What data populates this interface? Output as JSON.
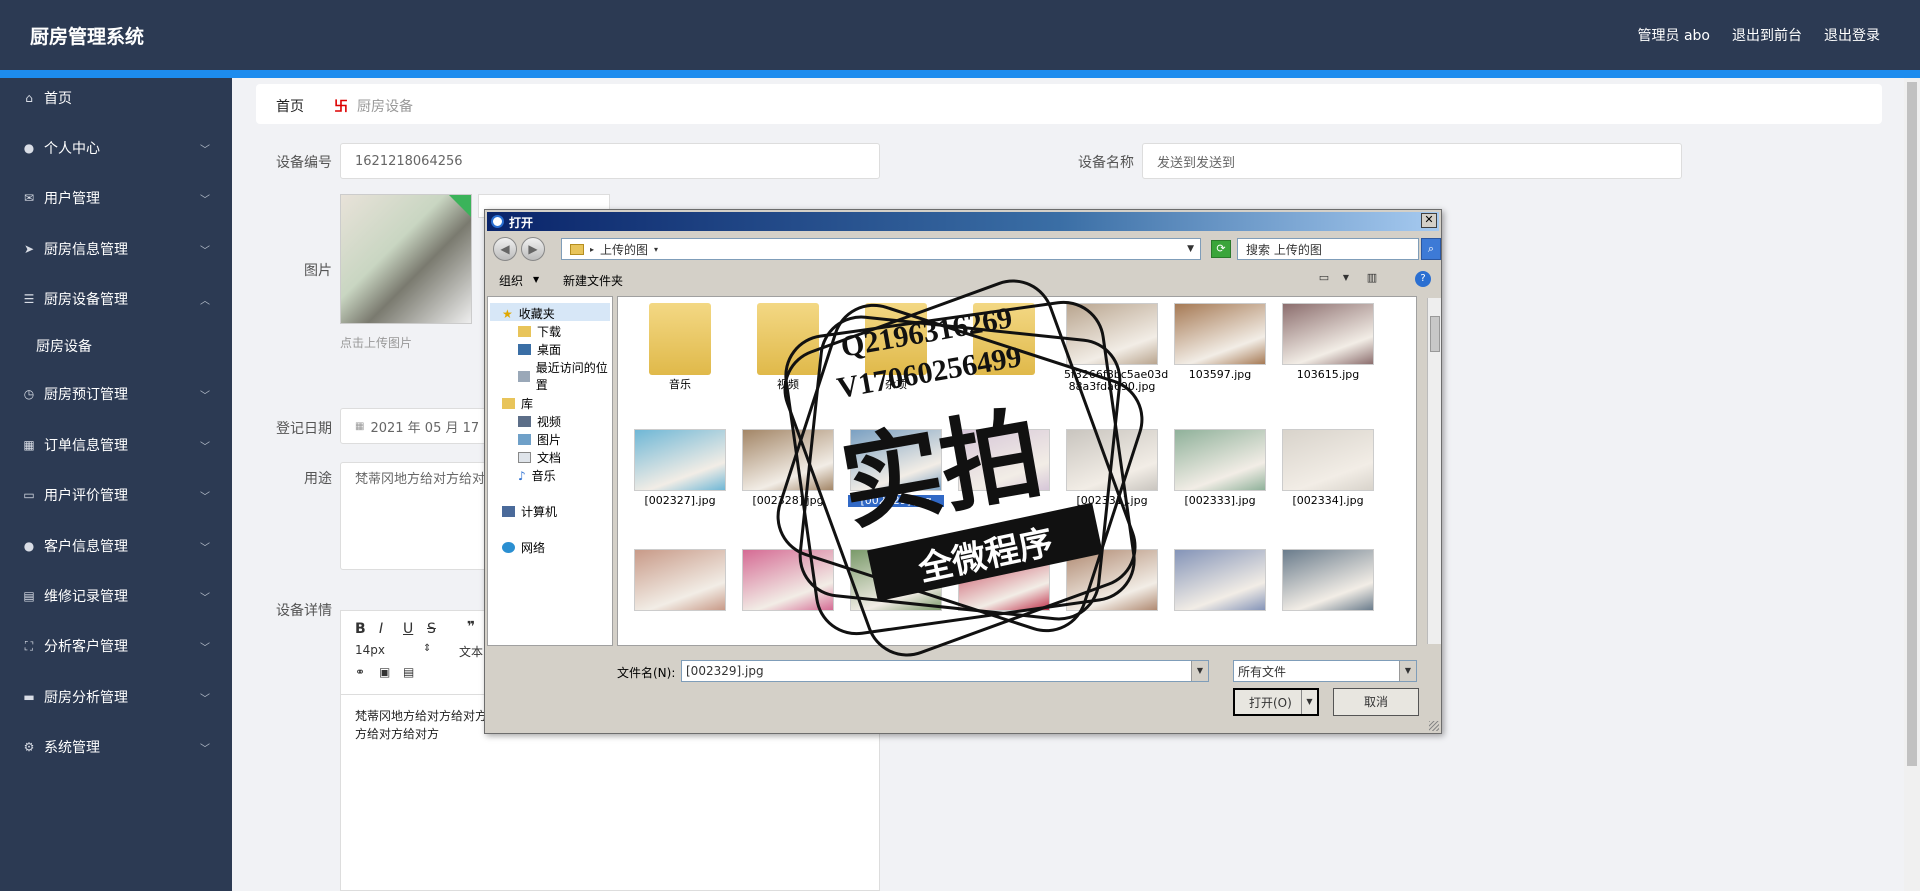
{
  "header": {
    "brand": "厨房管理系统",
    "admin": "管理员 abo",
    "to_front": "退出到前台",
    "logout": "退出登录"
  },
  "sidebar": {
    "items": [
      {
        "label": "首页",
        "icon": "home-icon",
        "expandable": false
      },
      {
        "label": "个人中心",
        "icon": "user-icon",
        "expandable": true
      },
      {
        "label": "用户管理",
        "icon": "mail-icon",
        "expandable": true
      },
      {
        "label": "厨房信息管理",
        "icon": "send-icon",
        "expandable": true
      },
      {
        "label": "厨房设备管理",
        "icon": "list-icon",
        "expandable": true,
        "open": true
      },
      {
        "label": "厨房预订管理",
        "icon": "clock-icon",
        "expandable": true
      },
      {
        "label": "订单信息管理",
        "icon": "grid-icon",
        "expandable": true
      },
      {
        "label": "用户评价管理",
        "icon": "monitor-icon",
        "expandable": true
      },
      {
        "label": "客户信息管理",
        "icon": "person-icon",
        "expandable": true
      },
      {
        "label": "维修记录管理",
        "icon": "clipboard-icon",
        "expandable": true
      },
      {
        "label": "分析客户管理",
        "icon": "scan-icon",
        "expandable": true
      },
      {
        "label": "厨房分析管理",
        "icon": "chat-icon",
        "expandable": true
      },
      {
        "label": "系统管理",
        "icon": "settings-icon",
        "expandable": true
      }
    ],
    "sub_item": "厨房设备"
  },
  "breadcrumb": {
    "home": "首页",
    "separator": "卐",
    "current": "厨房设备"
  },
  "form": {
    "device_no_label": "设备编号",
    "device_no_value": "1621218064256",
    "device_name_label": "设备名称",
    "device_name_value": "发送到发送到",
    "image_label": "图片",
    "upload_hint": "点击上传图片",
    "date_label": "登记日期",
    "date_value": "2021 年 05 月 17 日",
    "purpose_label": "用途",
    "purpose_value": "梵蒂冈地方给对方给对方给对方给对方梵蒂冈地方给对方给对方给对方给对方",
    "detail_label": "设备详情",
    "editor_fontsize": "14px",
    "editor_format": "文本",
    "editor_body": "梵蒂冈地方给对方给对方给对方给对方梵蒂冈地方给对方给对方给对方给对方给对方给对方给对方给对方给对方"
  },
  "dialog": {
    "title": "打开",
    "path": "上传的图",
    "search_placeholder": "搜索 上传的图",
    "organize": "组织",
    "new_folder": "新建文件夹",
    "nav": {
      "favorites": "收藏夹",
      "downloads": "下载",
      "desktop": "桌面",
      "recent": "最近访问的位置",
      "library": "库",
      "videos": "视频",
      "pictures": "图片",
      "documents": "文档",
      "music": "音乐",
      "computer": "计算机",
      "network": "网络"
    },
    "files": [
      {
        "name": "音乐",
        "kind": "folder"
      },
      {
        "name": "视频",
        "kind": "folder"
      },
      {
        "name": "杂项",
        "kind": "folder"
      },
      {
        "name": "",
        "kind": "folder"
      },
      {
        "name": "5f3266f8bc5ae03d 88a3fda690.jpg",
        "kind": "image",
        "color": "#b9a58f"
      },
      {
        "name": "103597.jpg",
        "kind": "image",
        "color": "#a67a55"
      },
      {
        "name": "103615.jpg",
        "kind": "image",
        "color": "#8c6e6e"
      },
      {
        "name": "[002327].jpg",
        "kind": "image",
        "color": "#6fb7d6"
      },
      {
        "name": "[002328].jpg",
        "kind": "image",
        "color": "#a38667"
      },
      {
        "name": "[002329].jpg",
        "kind": "image",
        "color": "#7aa0c2",
        "selected": true
      },
      {
        "name": "",
        "kind": "image",
        "color": "#d6c6d8"
      },
      {
        "name": "[002331].jpg",
        "kind": "image",
        "color": "#c9c5bf"
      },
      {
        "name": "[002333].jpg",
        "kind": "image",
        "color": "#8fb19a"
      },
      {
        "name": "[002334].jpg",
        "kind": "image",
        "color": "#d8d3cb"
      },
      {
        "name": "",
        "kind": "image",
        "color": "#c89a88"
      },
      {
        "name": "",
        "kind": "image",
        "color": "#d56b94"
      },
      {
        "name": "",
        "kind": "image",
        "color": "#7a9a6a"
      },
      {
        "name": "",
        "kind": "image",
        "color": "#c0304a"
      },
      {
        "name": "",
        "kind": "image",
        "color": "#b08a72"
      },
      {
        "name": "",
        "kind": "image",
        "color": "#8494b8"
      },
      {
        "name": "",
        "kind": "image",
        "color": "#6a7c8c"
      }
    ],
    "filename_label": "文件名(N):",
    "filename_value": "[002329].jpg",
    "filetype": "所有文件",
    "open_btn": "打开(O)",
    "cancel_btn": "取消"
  },
  "watermark": {
    "line1": "Q2196316269",
    "line2": "V17060256499",
    "big": "实拍",
    "ribbon": "全微程序"
  }
}
